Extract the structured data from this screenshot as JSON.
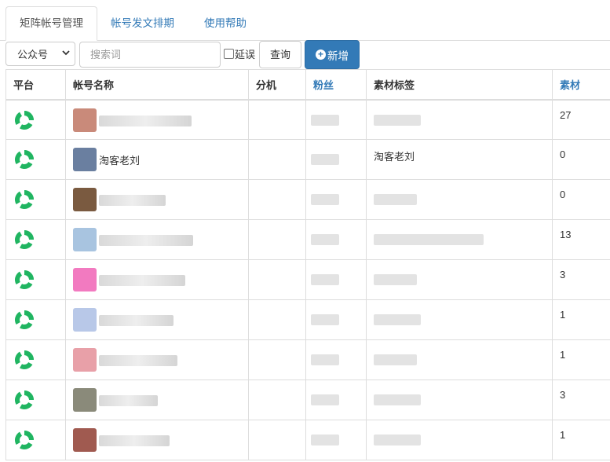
{
  "tabs": [
    {
      "label": "矩阵帐号管理",
      "active": true
    },
    {
      "label": "帐号发文排期",
      "active": false
    },
    {
      "label": "使用帮助",
      "active": false
    }
  ],
  "toolbar": {
    "platform_select": "公众号",
    "search_placeholder": "搜索词",
    "delay_checkbox_label": "延误",
    "query_button": "查询",
    "add_button": "新增"
  },
  "table": {
    "columns": [
      "平台",
      "帐号名称",
      "分机",
      "粉丝",
      "素材标签",
      "素材"
    ],
    "rows": [
      {
        "name": "",
        "tag": "",
        "material": "27"
      },
      {
        "name": "淘客老刘",
        "tag": "淘客老刘",
        "material": "0"
      },
      {
        "name": "",
        "tag": "",
        "material": "0"
      },
      {
        "name": "",
        "tag": "",
        "material": "13"
      },
      {
        "name": "",
        "tag": "",
        "material": "3"
      },
      {
        "name": "",
        "tag": "",
        "material": "1"
      },
      {
        "name": "",
        "tag": "",
        "material": "1"
      },
      {
        "name": "",
        "tag": "",
        "material": "3"
      },
      {
        "name": "",
        "tag": "",
        "material": "1"
      }
    ]
  },
  "colors": {
    "link_blue": "#337ab7",
    "platform_green": "#20b561",
    "border": "#dddddd"
  },
  "icons": {
    "platform": "wechat-official-account-icon",
    "add": "plus-circle-icon",
    "dropdown": "chevron-down-icon"
  }
}
